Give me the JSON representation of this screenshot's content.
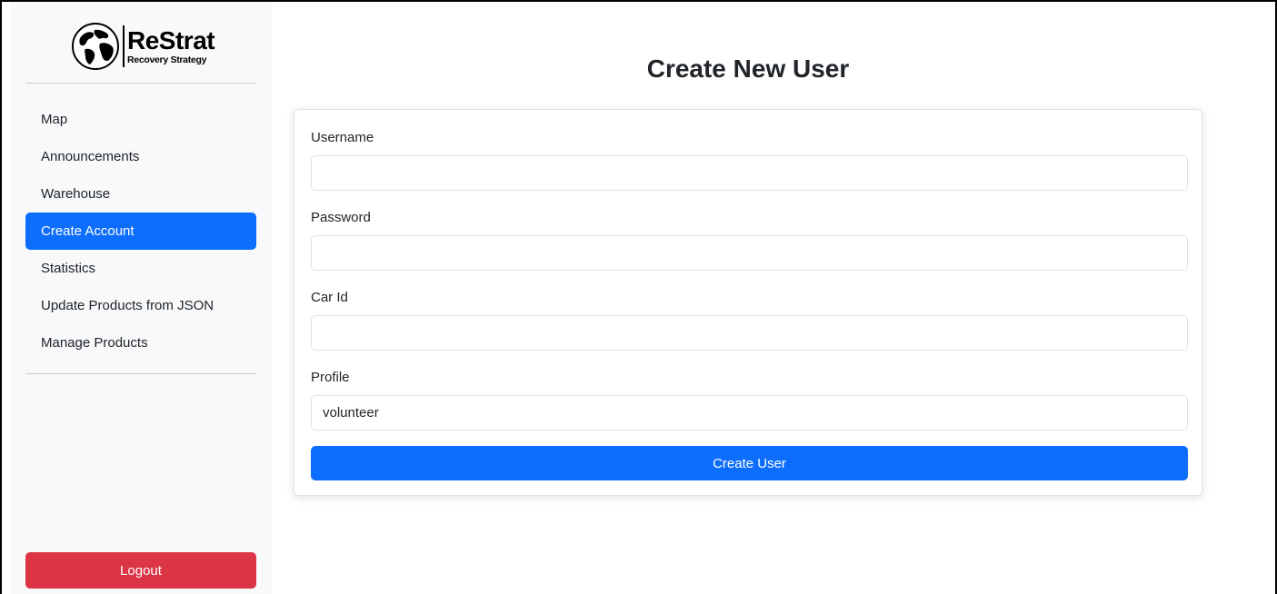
{
  "brand": {
    "name": "ReStrat",
    "tagline": "Recovery Strategy"
  },
  "sidebar": {
    "items": [
      {
        "label": "Map",
        "active": false
      },
      {
        "label": "Announcements",
        "active": false
      },
      {
        "label": "Warehouse",
        "active": false
      },
      {
        "label": "Create Account",
        "active": true
      },
      {
        "label": "Statistics",
        "active": false
      },
      {
        "label": "Update Products from JSON",
        "active": false
      },
      {
        "label": "Manage Products",
        "active": false
      }
    ],
    "logout_label": "Logout"
  },
  "main": {
    "title": "Create New User",
    "form": {
      "username": {
        "label": "Username",
        "value": ""
      },
      "password": {
        "label": "Password",
        "value": ""
      },
      "car_id": {
        "label": "Car Id",
        "value": ""
      },
      "profile": {
        "label": "Profile",
        "value": "volunteer"
      },
      "submit_label": "Create User"
    }
  },
  "colors": {
    "primary": "#0d6efd",
    "danger": "#dc3545",
    "sidebar_bg": "#f8f9fa"
  }
}
